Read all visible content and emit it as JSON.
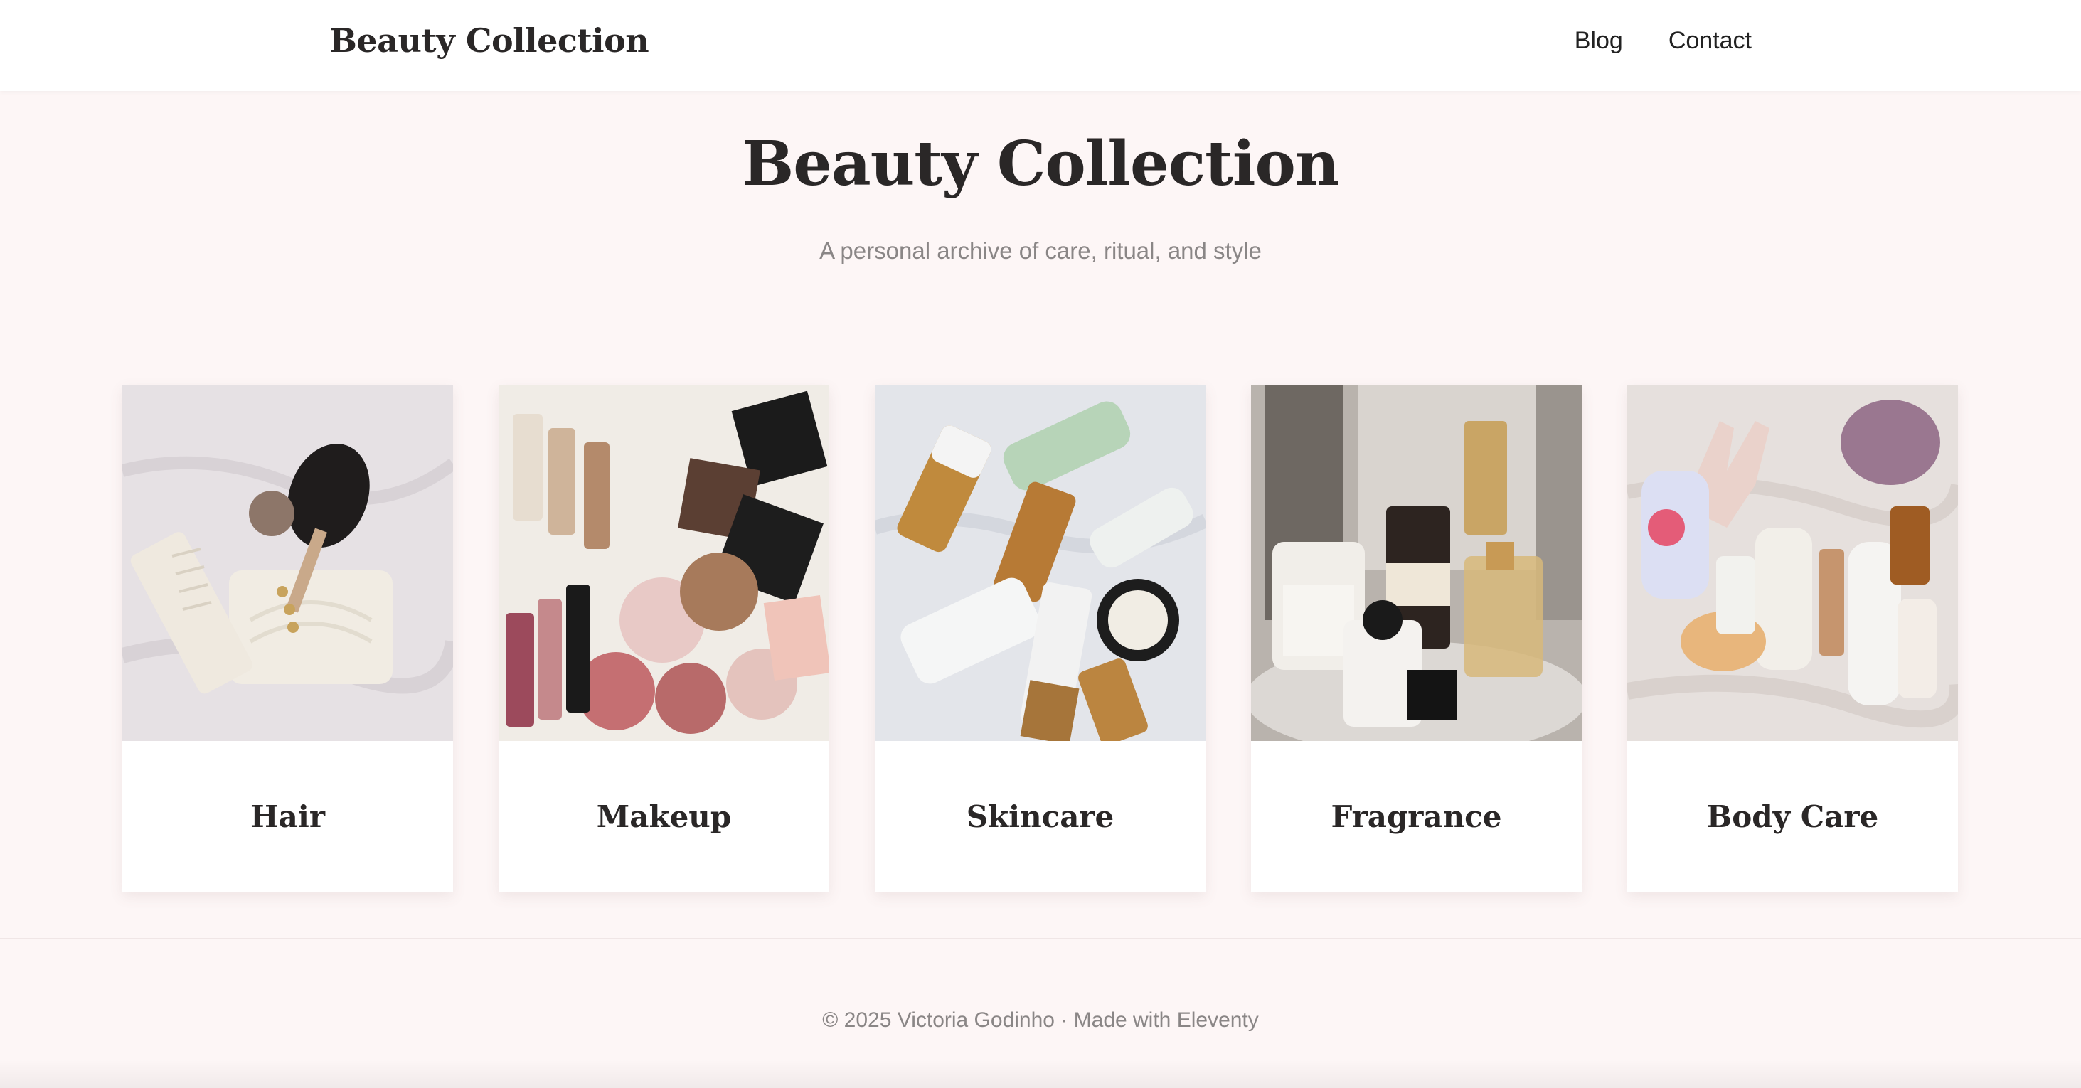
{
  "header": {
    "brand": "Beauty Collection",
    "nav": [
      {
        "label": "Blog"
      },
      {
        "label": "Contact"
      }
    ]
  },
  "hero": {
    "title": "Beauty Collection",
    "subtitle": "A personal archive of care, ritual, and style"
  },
  "categories": [
    {
      "label": "Hair",
      "image_icon": "hair-products-photo"
    },
    {
      "label": "Makeup",
      "image_icon": "makeup-products-photo"
    },
    {
      "label": "Skincare",
      "image_icon": "skincare-products-photo"
    },
    {
      "label": "Fragrance",
      "image_icon": "fragrance-bottles-photo"
    },
    {
      "label": "Body Care",
      "image_icon": "body-care-products-photo"
    }
  ],
  "footer": {
    "text": "© 2025 Victoria Godinho · Made with Eleventy"
  },
  "colors": {
    "page_background": "#fdf6f6",
    "header_background": "#ffffff",
    "text_dark": "#2a2727",
    "text_muted": "#8a8686"
  }
}
